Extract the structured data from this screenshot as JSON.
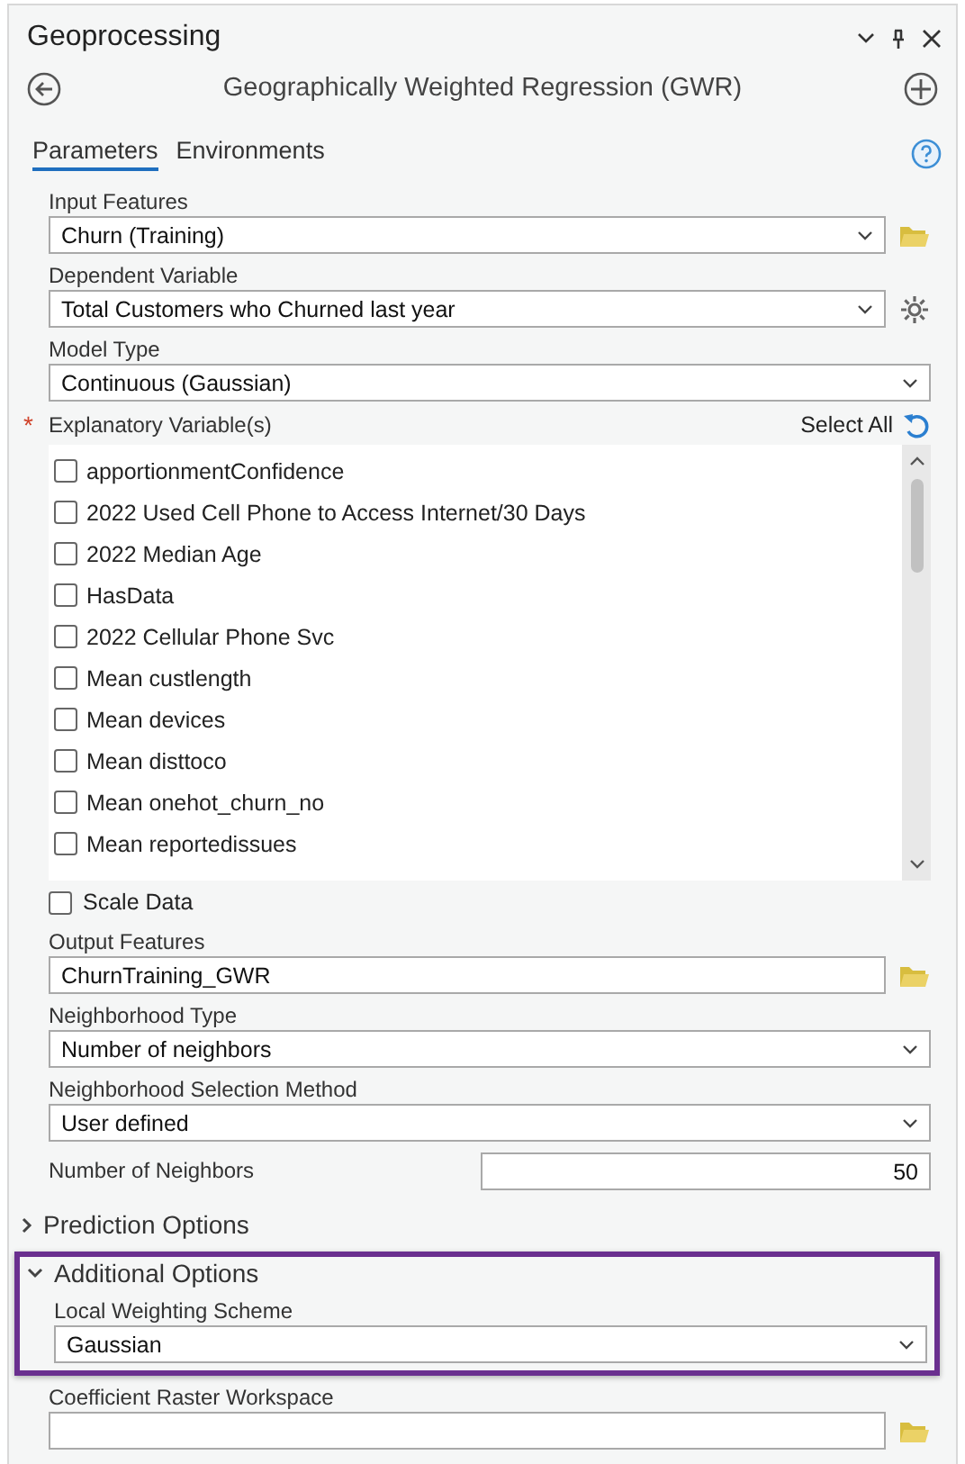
{
  "pane": {
    "title": "Geoprocessing"
  },
  "tool": {
    "title": "Geographically Weighted Regression (GWR)"
  },
  "tabs": [
    {
      "label": "Parameters",
      "selected": true
    },
    {
      "label": "Environments",
      "selected": false
    }
  ],
  "parameters": [
    {
      "kind": "dropdown",
      "label": "Input Features",
      "value": "Churn (Training)",
      "folder": true
    },
    {
      "kind": "dropdown",
      "label": "Dependent Variable",
      "value": "Total Customers who Churned last year",
      "gear": true
    },
    {
      "kind": "dropdown",
      "label": "Model Type",
      "value": "Continuous (Gaussian)"
    },
    {
      "kind": "checklist",
      "label": "Explanatory Variable(s)",
      "required_mark": "*",
      "action": "Select All",
      "items": [
        {
          "label": "apportionmentConfidence",
          "checked": false
        },
        {
          "label": "2022 Used Cell Phone to Access Internet/30 Days",
          "checked": false
        },
        {
          "label": "2022 Median Age",
          "checked": false
        },
        {
          "label": "HasData",
          "checked": false
        },
        {
          "label": "2022 Cellular Phone Svc",
          "checked": false
        },
        {
          "label": "Mean custlength",
          "checked": false
        },
        {
          "label": "Mean devices",
          "checked": false
        },
        {
          "label": "Mean disttoco",
          "checked": false
        },
        {
          "label": "Mean onehot_churn_no",
          "checked": false
        },
        {
          "label": "Mean reportedissues",
          "checked": false
        }
      ]
    },
    {
      "kind": "checkbox",
      "label": "Scale Data",
      "checked": false
    },
    {
      "kind": "text",
      "label": "Output Features",
      "value": "ChurnTraining_GWR",
      "folder": true
    },
    {
      "kind": "dropdown",
      "label": "Neighborhood Type",
      "value": "Number of neighbors"
    },
    {
      "kind": "dropdown",
      "label": "Neighborhood Selection Method",
      "value": "User defined"
    },
    {
      "kind": "number",
      "label": "Number of Neighbors",
      "value": "50"
    },
    {
      "kind": "section",
      "label": "Prediction Options",
      "expanded": false,
      "highlighted": false
    },
    {
      "kind": "section",
      "label": "Additional Options",
      "expanded": true,
      "highlighted": true,
      "children": [
        {
          "kind": "dropdown",
          "label": "Local Weighting Scheme",
          "value": "Gaussian"
        }
      ]
    },
    {
      "kind": "text",
      "label": "Coefficient Raster Workspace",
      "folder": true
    }
  ]
}
